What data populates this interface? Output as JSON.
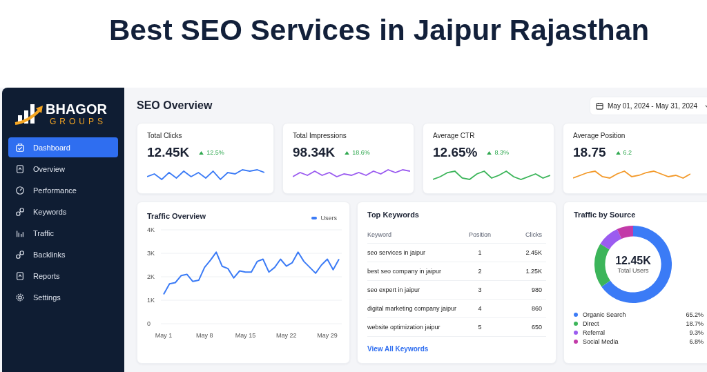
{
  "headline": "Best SEO Services in Jaipur Rajasthan",
  "brand": {
    "name": "BHAGOR",
    "tagline": "GROUPS"
  },
  "nav": [
    {
      "label": "Dashboard",
      "selected": true
    },
    {
      "label": "Overview",
      "selected": false
    },
    {
      "label": "Performance",
      "selected": false
    },
    {
      "label": "Keywords",
      "selected": false
    },
    {
      "label": "Traffic",
      "selected": false
    },
    {
      "label": "Backlinks",
      "selected": false
    },
    {
      "label": "Reports",
      "selected": false
    },
    {
      "label": "Settings",
      "selected": false
    }
  ],
  "page_title": "SEO Overview",
  "date_range": "May 01, 2024 - May 31, 2024",
  "metrics": [
    {
      "label": "Total Clicks",
      "value": "12.45K",
      "change": "12.5%",
      "color": "#3b7bf6"
    },
    {
      "label": "Total Impressions",
      "value": "98.34K",
      "change": "18.6%",
      "color": "#9b5cf0"
    },
    {
      "label": "Average CTR",
      "value": "12.65%",
      "change": "8.3%",
      "color": "#3cb55a"
    },
    {
      "label": "Average Position",
      "value": "18.75",
      "change": "6.2",
      "color": "#f39a2b"
    }
  ],
  "traffic_overview": {
    "title": "Traffic Overview",
    "chart_data": {
      "type": "line",
      "categories": [
        "May 1",
        null,
        null,
        null,
        null,
        null,
        null,
        "May 8",
        null,
        null,
        null,
        null,
        null,
        null,
        "May 15",
        null,
        null,
        null,
        null,
        null,
        null,
        "May 22",
        null,
        null,
        null,
        null,
        null,
        null,
        "May 29",
        null,
        null
      ],
      "series": [
        {
          "name": "Users",
          "color": "#3b7bf6",
          "values": [
            1250,
            1700,
            1750,
            2050,
            2100,
            1800,
            1850,
            2400,
            2700,
            3050,
            2450,
            2350,
            1950,
            2250,
            2200,
            2200,
            2650,
            2750,
            2200,
            2400,
            2750,
            2450,
            2600,
            3050,
            2650,
            2400,
            2150,
            2500,
            2750,
            2300,
            2750
          ]
        }
      ],
      "ylim": [
        0,
        4000
      ],
      "grid": true,
      "yticks": [
        {
          "value": 0,
          "label": "0"
        },
        {
          "value": 1000,
          "label": "1K"
        },
        {
          "value": 2000,
          "label": "2K"
        },
        {
          "value": 3000,
          "label": "3K"
        },
        {
          "value": 4000,
          "label": "4K"
        }
      ]
    }
  },
  "top_keywords": {
    "title": "Top Keywords",
    "columns": [
      "Keyword",
      "Position",
      "Clicks"
    ],
    "rows": [
      [
        "seo services in jaipur",
        "1",
        "2.45K"
      ],
      [
        "best seo company in jaipur",
        "2",
        "1.25K"
      ],
      [
        "seo expert in jaipur",
        "3",
        "980"
      ],
      [
        "digital marketing company jaipur",
        "4",
        "860"
      ],
      [
        "website optimization jaipur",
        "5",
        "650"
      ]
    ],
    "link": "View All Keywords"
  },
  "traffic_by_source": {
    "title": "Traffic by Source",
    "total": "12.45K",
    "total_label": "Total Users",
    "chart_data": {
      "type": "donut",
      "categories": [
        "Organic Search",
        "Direct",
        "Referral",
        "Social Media"
      ],
      "values": [
        65.2,
        18.7,
        9.3,
        6.8
      ]
    },
    "legend": [
      {
        "percent": "65.2%",
        "color": "#3b7bf6"
      },
      {
        "percent": "18.7%",
        "color": "#3cb55a"
      },
      {
        "percent": "9.3%",
        "color": "#9b5cf0"
      },
      {
        "percent": "6.8%",
        "color": "#c23aa8"
      }
    ]
  }
}
